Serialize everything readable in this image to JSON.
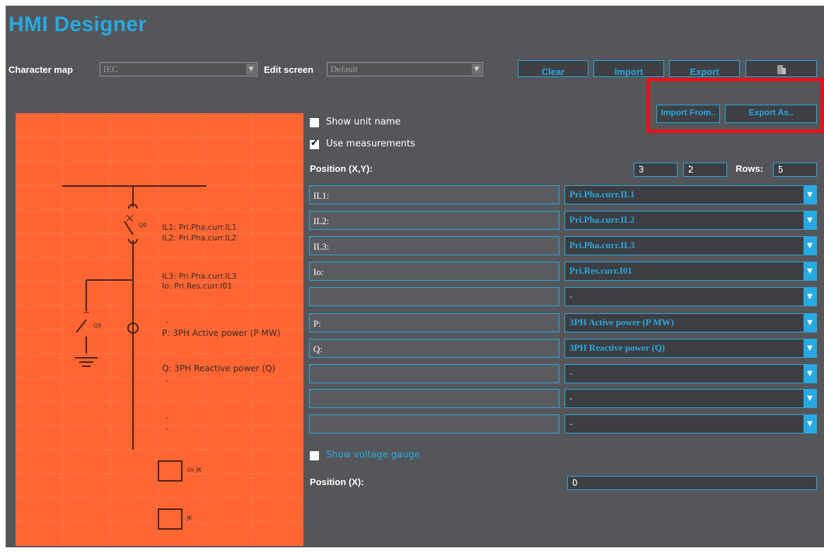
{
  "app": {
    "title": "HMI Designer"
  },
  "toolbar": {
    "character_map_label": "Character map",
    "character_map_value": "IEC",
    "edit_screen_label": "Edit screen",
    "edit_screen_value": "Default",
    "clear_label": "Clear",
    "import_label": "Import",
    "export_label": "Export",
    "import_from_label": "Import From..",
    "export_as_label": "Export As.."
  },
  "options": {
    "show_unit_name": {
      "label": "Show unit name",
      "checked": false
    },
    "use_measurements": {
      "label": "Use measurements",
      "checked": true
    },
    "position_xy_label": "Position (X,Y):",
    "x_value": "3",
    "y_value": "2",
    "rows_label": "Rows:",
    "rows_value": "5",
    "show_voltage_gauge": {
      "label": "Show voltage gauge",
      "checked": false
    },
    "position_x_label": "Position (X):",
    "position_x_value": "0"
  },
  "measurements": [
    {
      "label": "IL1:",
      "value": "Pri.Pha.curr.IL1"
    },
    {
      "label": "IL2:",
      "value": "Pri.Pha.curr.IL2"
    },
    {
      "label": "IL3:",
      "value": "Pri.Pha.curr.IL3"
    },
    {
      "label": "Io:",
      "value": "Pri.Res.curr.I01"
    },
    {
      "label": "",
      "value": "-"
    },
    {
      "label": "P:",
      "value": "3PH Active power (P MW)"
    },
    {
      "label": "Q:",
      "value": "3PH Reactive power (Q)"
    },
    {
      "label": "",
      "value": "-"
    },
    {
      "label": "",
      "value": "-"
    },
    {
      "label": "",
      "value": "-"
    }
  ],
  "preview": {
    "q0_label": "Q0",
    "q9_label": "Q9",
    "line_il1": "IL1: Pri.Pha.curr.IL1",
    "line_il2": "IL2: Pri.Pha.curr.IL2",
    "line_il3": "IL3: Pri.Pha.curr.IL3",
    "line_io": "Io: Pri.Res.curr.I01",
    "line_dash1": "-",
    "line_p": "P: 3PH Active power (P MW)",
    "line_q": "Q: 3PH Reactive power (Q)",
    "line_dash2": "-",
    "line_dash3": "-",
    "line_dash4": "-",
    "uo_label": "Uo JK",
    "jk_label": "JK"
  },
  "colors": {
    "accent": "#27a9e1",
    "panel": "#555659",
    "preview_bg": "#ff6633",
    "highlight": "#e8101a"
  }
}
